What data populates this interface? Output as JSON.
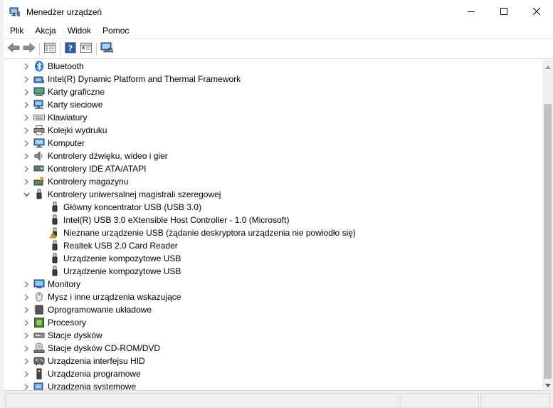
{
  "window": {
    "title": "Menedżer urządzeń",
    "icon": "device-manager-icon",
    "controls": [
      "minimize-icon",
      "maximize-icon",
      "close-icon"
    ]
  },
  "menu": {
    "items": [
      "Plik",
      "Akcja",
      "Widok",
      "Pomoc"
    ]
  },
  "toolbar": {
    "buttons": [
      "back-arrow-icon",
      "forward-arrow-icon",
      "properties-icon",
      "help-icon",
      "update-driver-icon",
      "scan-hardware-icon"
    ]
  },
  "tree": {
    "items": [
      {
        "label": "Bluetooth",
        "icon": "bluetooth-icon"
      },
      {
        "label": "Intel(R) Dynamic Platform and Thermal Framework",
        "icon": "device-icon"
      },
      {
        "label": "Karty graficzne",
        "icon": "display-adapter-icon"
      },
      {
        "label": "Karty sieciowe",
        "icon": "network-adapter-icon"
      },
      {
        "label": "Klawiatury",
        "icon": "keyboard-icon"
      },
      {
        "label": "Kolejki wydruku",
        "icon": "printer-icon"
      },
      {
        "label": "Komputer",
        "icon": "computer-icon"
      },
      {
        "label": "Kontrolery dźwięku, wideo i gier",
        "icon": "speaker-icon"
      },
      {
        "label": "Kontrolery IDE ATA/ATAPI",
        "icon": "ide-controller-icon"
      },
      {
        "label": "Kontrolery magazynu",
        "icon": "storage-controller-icon"
      },
      {
        "label": "Kontrolery uniwersalnej magistrali szeregowej",
        "icon": "usb-icon",
        "expanded": true
      }
    ],
    "usb_children": [
      {
        "label": "Główny koncentrator USB (USB 3.0)",
        "icon": "usb-plug-icon"
      },
      {
        "label": "Intel(R) USB 3.0 eXtensible Host Controller - 1.0 (Microsoft)",
        "icon": "usb-plug-icon"
      },
      {
        "label": "Nieznane urządzenie USB (żądanie deskryptora urządzenia nie powiodło się)",
        "icon": "warning-icon"
      },
      {
        "label": "Realtek USB 2.0 Card Reader",
        "icon": "usb-plug-icon"
      },
      {
        "label": "Urządzenie kompozytowe USB",
        "icon": "usb-plug-icon"
      },
      {
        "label": "Urządzenie kompozytowe USB",
        "icon": "usb-plug-icon"
      }
    ],
    "items_after": [
      {
        "label": "Monitory",
        "icon": "monitor-icon"
      },
      {
        "label": "Mysz i inne urządzenia wskazujące",
        "icon": "mouse-icon"
      },
      {
        "label": "Oprogramowanie układowe",
        "icon": "firmware-icon"
      },
      {
        "label": "Procesory",
        "icon": "processor-icon"
      },
      {
        "label": "Stacje dysków",
        "icon": "disk-drive-icon"
      },
      {
        "label": "Stacje dysków CD-ROM/DVD",
        "icon": "dvd-drive-icon"
      },
      {
        "label": "Urządzenia interfejsu HID",
        "icon": "hid-icon"
      },
      {
        "label": "Urządzenia programowe",
        "icon": "software-device-icon"
      },
      {
        "label": "Urządzenia systemowe",
        "icon": "system-device-icon"
      }
    ]
  },
  "colors": {
    "accent": "#1e73be",
    "warning": "#f2c200",
    "scroll_thumb": "#c2c2c2"
  }
}
